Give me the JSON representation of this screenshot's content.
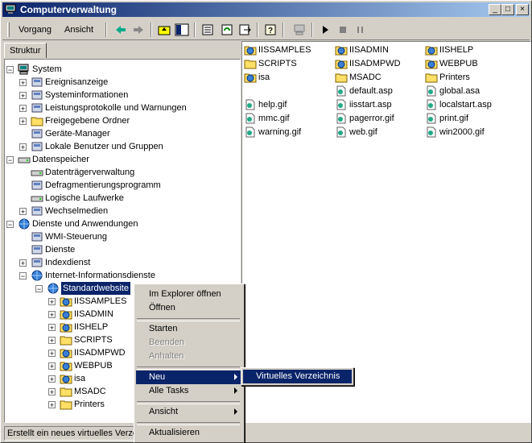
{
  "window": {
    "title": "Computerverwaltung"
  },
  "toolbar": {
    "vorgang_label": "Vorgang",
    "ansicht_label": "Ansicht"
  },
  "tab": {
    "label": "Struktur"
  },
  "tree": [
    {
      "label": "System",
      "level": 0,
      "expander": "-",
      "icon": "computer-icon"
    },
    {
      "label": "Ereignisanzeige",
      "level": 1,
      "expander": "+",
      "icon": "event-viewer-icon"
    },
    {
      "label": "Systeminformationen",
      "level": 1,
      "expander": "+",
      "icon": "sysinfo-icon"
    },
    {
      "label": "Leistungsprotokolle und Warnungen",
      "level": 1,
      "expander": "+",
      "icon": "performance-icon"
    },
    {
      "label": "Freigegebene Ordner",
      "level": 1,
      "expander": "+",
      "icon": "shared-folder-icon"
    },
    {
      "label": "Geräte-Manager",
      "level": 1,
      "expander": "",
      "icon": "device-manager-icon"
    },
    {
      "label": "Lokale Benutzer und Gruppen",
      "level": 1,
      "expander": "+",
      "icon": "users-icon"
    },
    {
      "label": "Datenspeicher",
      "level": 0,
      "expander": "-",
      "icon": "storage-icon"
    },
    {
      "label": "Datenträgerverwaltung",
      "level": 1,
      "expander": "",
      "icon": "disk-icon"
    },
    {
      "label": "Defragmentierungsprogramm",
      "level": 1,
      "expander": "",
      "icon": "defrag-icon"
    },
    {
      "label": "Logische Laufwerke",
      "level": 1,
      "expander": "",
      "icon": "drive-icon"
    },
    {
      "label": "Wechselmedien",
      "level": 1,
      "expander": "+",
      "icon": "removable-media-icon"
    },
    {
      "label": "Dienste und Anwendungen",
      "level": 0,
      "expander": "-",
      "icon": "services-apps-icon"
    },
    {
      "label": "WMI-Steuerung",
      "level": 1,
      "expander": "",
      "icon": "wmi-icon"
    },
    {
      "label": "Dienste",
      "level": 1,
      "expander": "",
      "icon": "services-icon"
    },
    {
      "label": "Indexdienst",
      "level": 1,
      "expander": "+",
      "icon": "index-icon"
    },
    {
      "label": "Internet-Informationsdienste",
      "level": 1,
      "expander": "-",
      "icon": "iis-icon"
    },
    {
      "label": "Standardwebsite",
      "level": 2,
      "expander": "-",
      "icon": "globe-icon",
      "selected": true
    },
    {
      "label": "IISSAMPLES",
      "level": 3,
      "expander": "+",
      "icon": "web-folder-icon"
    },
    {
      "label": "IISADMIN",
      "level": 3,
      "expander": "+",
      "icon": "web-folder-icon"
    },
    {
      "label": "IISHELP",
      "level": 3,
      "expander": "+",
      "icon": "web-folder-icon"
    },
    {
      "label": "SCRIPTS",
      "level": 3,
      "expander": "+",
      "icon": "folder-icon"
    },
    {
      "label": "IISADMPWD",
      "level": 3,
      "expander": "+",
      "icon": "web-folder-icon"
    },
    {
      "label": "WEBPUB",
      "level": 3,
      "expander": "+",
      "icon": "web-folder-icon"
    },
    {
      "label": "isa",
      "level": 3,
      "expander": "+",
      "icon": "web-folder-icon"
    },
    {
      "label": "MSADC",
      "level": 3,
      "expander": "+",
      "icon": "folder-icon"
    },
    {
      "label": "Printers",
      "level": 3,
      "expander": "+",
      "icon": "folder-icon"
    }
  ],
  "list": [
    [
      "IISSAMPLES",
      "IISADMIN",
      "IISHELP"
    ],
    [
      "SCRIPTS",
      "IISADMPWD",
      "WEBPUB"
    ],
    [
      "isa",
      "MSADC",
      "Printers"
    ],
    [
      "",
      "default.asp",
      "global.asa"
    ],
    [
      "help.gif",
      "iisstart.asp",
      "localstart.asp"
    ],
    [
      "mmc.gif",
      "pagerror.gif",
      "print.gif"
    ],
    [
      "warning.gif",
      "web.gif",
      "win2000.gif"
    ]
  ],
  "list_icons": [
    [
      "web-folder-icon",
      "web-folder-icon",
      "web-folder-icon"
    ],
    [
      "folder-icon",
      "web-folder-icon",
      "web-folder-icon"
    ],
    [
      "web-folder-icon",
      "folder-icon",
      "folder-icon"
    ],
    [
      "",
      "asp-file-icon",
      "asa-file-icon"
    ],
    [
      "gif-file-icon",
      "asp-file-icon",
      "asp-file-icon"
    ],
    [
      "gif-file-icon",
      "gif-file-icon",
      "gif-file-icon"
    ],
    [
      "gif-file-icon",
      "gif-file-icon",
      "gif-file-icon"
    ]
  ],
  "context_menu": {
    "open_explorer": "Im Explorer öffnen",
    "open": "Öffnen",
    "start": "Starten",
    "stop": "Beenden",
    "pause": "Anhalten",
    "new": "Neu",
    "all_tasks": "Alle Tasks",
    "view": "Ansicht",
    "refresh": "Aktualisieren"
  },
  "submenu": {
    "virtual_dir": "Virtuelles Verzeichnis"
  },
  "status": {
    "text": "Erstellt ein neues virtuelles Verzeichnis"
  },
  "colors": {
    "titlebar": "#0a246a",
    "selection": "#0a246a",
    "face": "#d4d0c8"
  }
}
